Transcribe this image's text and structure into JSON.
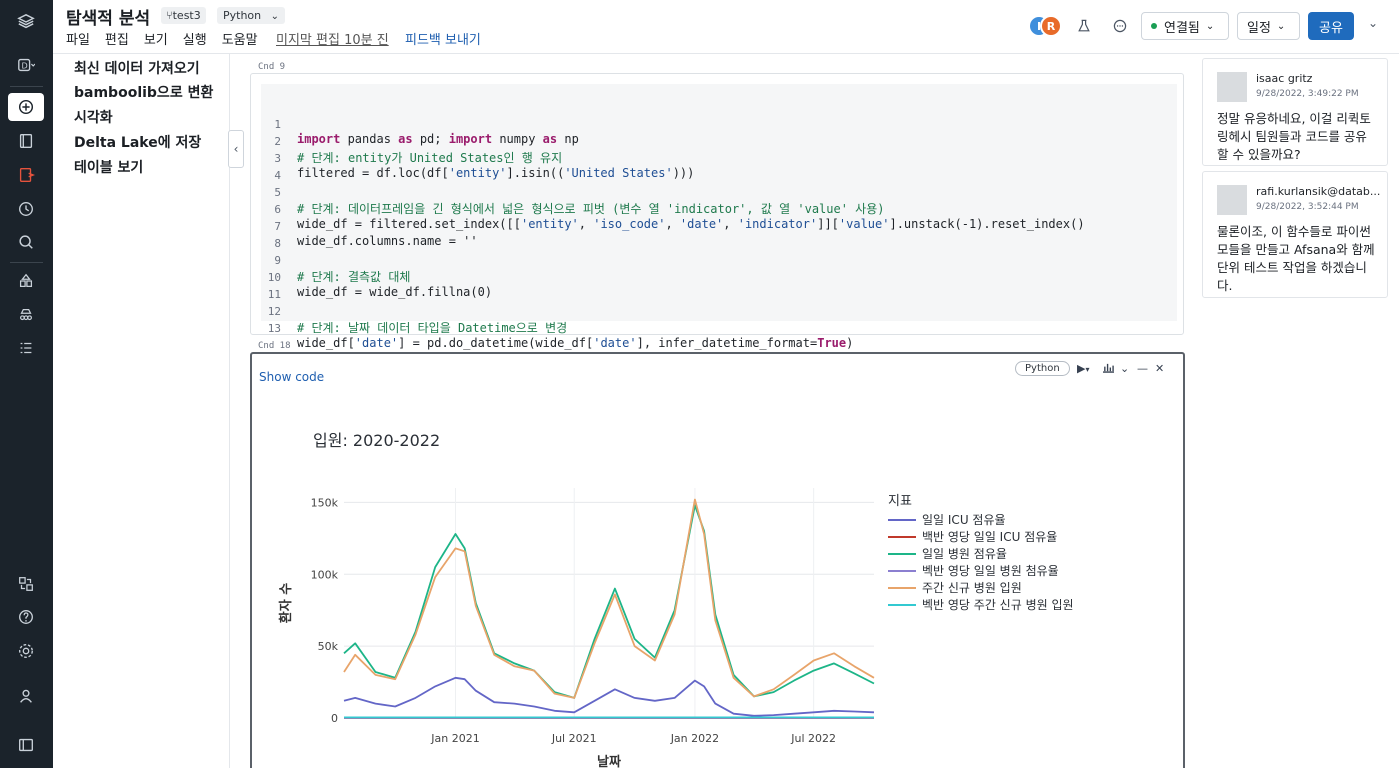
{
  "header": {
    "title": "탐색적 분석",
    "branch": "test3",
    "language": "Python",
    "menu": [
      "파일",
      "편집",
      "보기",
      "실행",
      "도움말"
    ],
    "last_edit": "미지막 편집 10분 진",
    "feedback": "피드백 보내기",
    "avatars": [
      {
        "initial": "I",
        "color": "#3f8fdc"
      },
      {
        "initial": "R",
        "color": "#e86b2a"
      }
    ],
    "connection_label": "연결됨",
    "connection_status_color": "#1a9e54",
    "schedule_label": "일정",
    "share_label": "공유"
  },
  "rail": {
    "items": [
      "workspace-logo",
      "data-science-icon",
      "new-icon",
      "notebook-icon",
      "repos-icon",
      "recents-icon",
      "search-icon",
      "data-icon",
      "clusters-icon",
      "jobs-icon",
      "partner-connect-icon",
      "help-icon",
      "settings-icon",
      "account-icon",
      "collapse-sidebar-icon"
    ],
    "workspace_letter": "D"
  },
  "toc": {
    "items": [
      "최신 데이터 가져오기",
      "bamboolib으로 변환",
      "시각화",
      "Delta Lake에 저장",
      "테이블 보기"
    ]
  },
  "cells": {
    "code_cell": {
      "label": "Cnd 9",
      "lines": [
        {
          "n": "1",
          "text": ""
        },
        {
          "n": "2",
          "text": "# 단계: entity가 United States인 행 유지"
        },
        {
          "n": "3",
          "text": ""
        },
        {
          "n": "4",
          "text": ""
        },
        {
          "n": "5",
          "text": "# 단계: 데이터프레임을 긴 형식에서 넓은 형식으로 피벗 (변수 열 'indicator', 값 열 'value' 사용)"
        },
        {
          "n": "6",
          "text": ""
        },
        {
          "n": "7",
          "text": "wide_df.columns.name = ''"
        },
        {
          "n": "8",
          "text": ""
        },
        {
          "n": "9",
          "text": "# 단계: 결측값 대체"
        },
        {
          "n": "10",
          "text": "wide_df = wide_df.fillna(0)"
        },
        {
          "n": "11",
          "text": ""
        },
        {
          "n": "12",
          "text": "# 단계: 날짜 데이터 타입을 Datetime으로 변경"
        },
        {
          "n": "13",
          "text": ""
        }
      ],
      "tokens": {
        "l1_kw1": "import",
        "l1_t1": " pandas ",
        "l1_kw2": "as",
        "l1_t2": " pd; ",
        "l1_kw3": "import",
        "l1_t3": " numpy ",
        "l1_kw4": "as",
        "l1_t4": " np",
        "l3_t1": "filtered = df.loc(df[",
        "l3_s1": "'entity'",
        "l3_t2": "].isin((",
        "l3_s2": "'United States'",
        "l3_t3": ")))",
        "l6_t1": "wide_df = filtered.set_index([[",
        "l6_s1": "'entity'",
        "l6_t2": ", ",
        "l6_s2": "'iso_code'",
        "l6_t3": ", ",
        "l6_s3": "'date'",
        "l6_t4": ", ",
        "l6_s4": "'indicator'",
        "l6_t5": "]][",
        "l6_s5": "'value'",
        "l6_t6": "].unstack(-1).reset_index()",
        "l13_t1": "wide_df[",
        "l13_s1": "'date'",
        "l13_t2": "] = pd.do_datetime(wide_df[",
        "l13_s2": "'date'",
        "l13_t3": "], infer_datetime_format=",
        "l13_b1": "True",
        "l13_t4": ")"
      }
    },
    "chart_cell": {
      "label": "Cnd 18",
      "show_code": "Show code",
      "language": "Python"
    }
  },
  "chart_data": {
    "type": "line",
    "title": "입원: 2020-2022",
    "xlabel": "날짜",
    "ylabel": "환자 수",
    "x_ticks": [
      "Jan 2021",
      "Jul 2021",
      "Jan 2022",
      "Jul 2022"
    ],
    "y_ticks": [
      "0",
      "50k",
      "100k",
      "150k"
    ],
    "ylim": [
      0,
      160000
    ],
    "xlim": [
      "2020-07-15",
      "2022-10-01"
    ],
    "grid": true,
    "legend_title": "지표",
    "legend_position": "right",
    "x": [
      "2020-07-15",
      "2020-08-01",
      "2020-09-01",
      "2020-10-01",
      "2020-11-01",
      "2020-12-01",
      "2021-01-01",
      "2021-01-15",
      "2021-02-01",
      "2021-03-01",
      "2021-04-01",
      "2021-05-01",
      "2021-06-01",
      "2021-07-01",
      "2021-08-01",
      "2021-09-01",
      "2021-10-01",
      "2021-11-01",
      "2021-12-01",
      "2022-01-01",
      "2022-01-15",
      "2022-02-01",
      "2022-03-01",
      "2022-04-01",
      "2022-05-01",
      "2022-06-01",
      "2022-07-01",
      "2022-08-01",
      "2022-09-01",
      "2022-10-01"
    ],
    "series": [
      {
        "name": "일일 ICU 점유율",
        "color": "#6366c7",
        "values": [
          12000,
          14000,
          10000,
          8000,
          14000,
          22000,
          28000,
          27000,
          19000,
          11000,
          10000,
          8000,
          5000,
          4000,
          12000,
          20000,
          14000,
          12000,
          14000,
          26000,
          22000,
          10000,
          3000,
          1500,
          2000,
          3000,
          4000,
          5000,
          4500,
          4000
        ]
      },
      {
        "name": "백반 영당 일일 ICU 점유율",
        "color": "#c0392b",
        "values": [
          30,
          30,
          30,
          30,
          30,
          30,
          30,
          30,
          30,
          30,
          30,
          30,
          30,
          30,
          30,
          30,
          30,
          30,
          30,
          30,
          30,
          30,
          30,
          30,
          30,
          30,
          30,
          30,
          30,
          30
        ]
      },
      {
        "name": "일일 병원 점유율",
        "color": "#1db588",
        "values": [
          45000,
          52000,
          32000,
          28000,
          60000,
          105000,
          128000,
          118000,
          80000,
          45000,
          38000,
          33000,
          18000,
          14000,
          55000,
          90000,
          55000,
          42000,
          75000,
          148000,
          130000,
          72000,
          30000,
          15000,
          18000,
          26000,
          33000,
          38000,
          31000,
          24000
        ]
      },
      {
        "name": "벡반 영당 일일 병원 첨유율",
        "color": "#8b7fd0",
        "values": [
          150,
          150,
          150,
          150,
          150,
          150,
          150,
          150,
          150,
          150,
          150,
          150,
          150,
          150,
          150,
          150,
          150,
          150,
          150,
          150,
          150,
          150,
          150,
          150,
          150,
          150,
          150,
          150,
          150,
          150
        ]
      },
      {
        "name": "주간 신규 병원 입원",
        "color": "#e8a46a",
        "values": [
          32000,
          44000,
          30000,
          27000,
          58000,
          98000,
          118000,
          116000,
          78000,
          44000,
          36000,
          33000,
          17000,
          14000,
          52000,
          86000,
          50000,
          40000,
          72000,
          152000,
          128000,
          68000,
          28000,
          15000,
          20000,
          30000,
          40000,
          45000,
          36000,
          28000
        ]
      },
      {
        "name": "벡반 영당 주간 신규 병원 입원",
        "color": "#33c9d1",
        "values": [
          400,
          400,
          400,
          400,
          400,
          400,
          400,
          400,
          400,
          400,
          400,
          400,
          400,
          400,
          400,
          400,
          400,
          400,
          400,
          400,
          400,
          400,
          400,
          400,
          400,
          400,
          400,
          400,
          400,
          400
        ]
      }
    ]
  },
  "comments": [
    {
      "author": "isaac gritz",
      "time": "9/28/2022, 3:49:22 PM",
      "lines": [
        "정말 유응하네요, 이걸 리퀵토",
        "링헤시 팀원들과 코드를 공유",
        "할 수 있을까요?"
      ]
    },
    {
      "author": "rafi.kurlansik@datab...",
      "time": "9/28/2022, 3:52:44 PM",
      "lines": [
        "물론이조, 이 함수들로 파이썬",
        "모들을 만들고 Afsana와 함께",
        "단위 테스트 작업을 하겠습니",
        "다."
      ]
    }
  ]
}
